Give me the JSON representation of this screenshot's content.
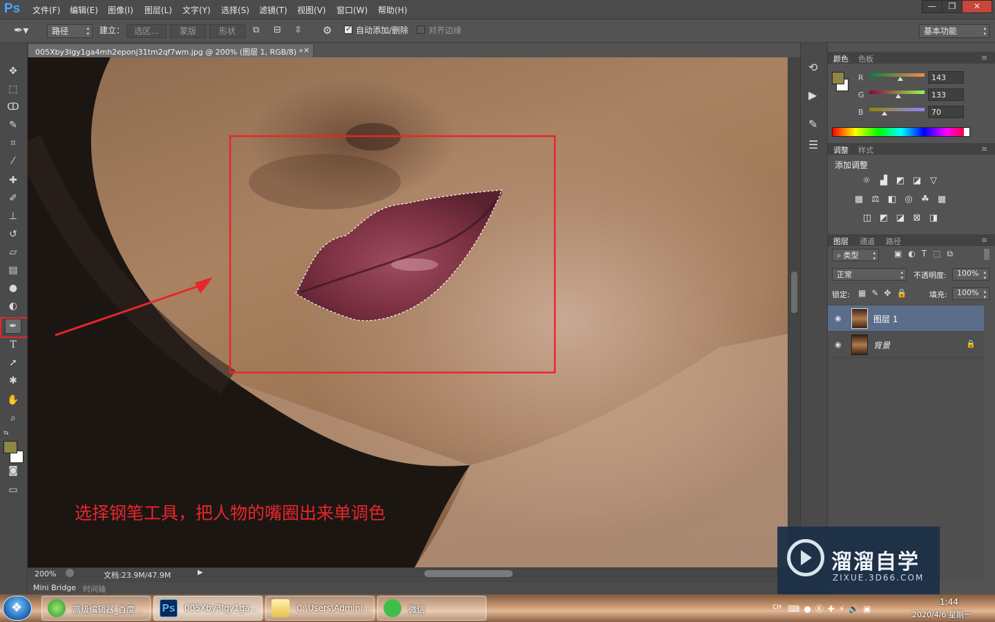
{
  "app": {
    "logo": "Ps"
  },
  "menu": [
    "文件(F)",
    "编辑(E)",
    "图像(I)",
    "图层(L)",
    "文字(Y)",
    "选择(S)",
    "滤镜(T)",
    "视图(V)",
    "窗口(W)",
    "帮助(H)"
  ],
  "window_controls": [
    "—",
    "❐",
    "✕"
  ],
  "options": {
    "mode": "路径",
    "make_label": "建立：",
    "btn_selection": "选区...",
    "btn_mask": "蒙版",
    "btn_shape": "形状",
    "auto_add_delete": "自动添加/删除",
    "auto_add_delete_checked": true,
    "align_edges": "对齐边缘",
    "align_edges_checked": false,
    "workspace": "基本功能"
  },
  "document": {
    "tab_title": "005Xby3Igy1ga4mh2eponj31tm2qf7wm.jpg @ 200% (图层 1, RGB/8) *",
    "close": "×"
  },
  "annotation": {
    "caption": "选择钢笔工具，把人物的嘴圈出来单调色",
    "color": "#e8262a"
  },
  "status": {
    "zoom": "200%",
    "doc_info": "文档:23.9M/47.9M"
  },
  "bottom_tabs": [
    "Mini Bridge",
    "时间轴"
  ],
  "color_panel": {
    "tabs": [
      "颜色",
      "色板"
    ],
    "r_label": "R",
    "r": "143",
    "g_label": "G",
    "g": "133",
    "b_label": "B",
    "b": "70",
    "foreground": "#8f8546",
    "r_level": 143,
    "g_level": 133,
    "b_level": 70
  },
  "adjust_panel": {
    "tabs": [
      "调整",
      "样式"
    ],
    "title": "添加调整"
  },
  "layers_panel": {
    "tabs": [
      "图层",
      "通道",
      "路径"
    ],
    "filter": "类型",
    "blend_mode": "正常",
    "opacity_label": "不透明度:",
    "opacity": "100%",
    "lock_label": "锁定:",
    "fill_label": "填充:",
    "fill": "100%",
    "layers": [
      {
        "name": "图层 1",
        "selected": true,
        "locked": false
      },
      {
        "name": "背景",
        "selected": false,
        "locked": true
      }
    ]
  },
  "watermark": {
    "brand": "溜溜自学",
    "url": "ZIXUE.3D66.COM"
  },
  "taskbar": {
    "items": [
      {
        "label": "高级编辑器_百度..."
      },
      {
        "label": "005Xby3Igy1ga..."
      },
      {
        "label": "C:\\Users\\Admini..."
      },
      {
        "label": "微信"
      }
    ],
    "ime": "CH",
    "time": "1:44",
    "date": "2020/4/6 星期一"
  }
}
